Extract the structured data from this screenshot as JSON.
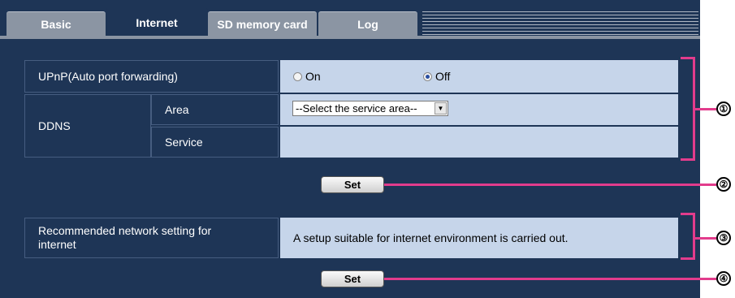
{
  "tabs": [
    {
      "label": "Basic",
      "active": false
    },
    {
      "label": "Internet",
      "active": true
    },
    {
      "label": "SD memory card",
      "active": false
    },
    {
      "label": "Log",
      "active": false
    }
  ],
  "upnp": {
    "label": "UPnP(Auto port forwarding)",
    "options": [
      "On",
      "Off"
    ],
    "selected": "Off"
  },
  "ddns": {
    "label": "DDNS",
    "area_label": "Area",
    "area_value": "--Select the service area--",
    "service_label": "Service",
    "service_value": ""
  },
  "set_button_1": "Set",
  "recommended": {
    "label": "Recommended network setting for internet",
    "description": "A setup suitable for internet environment is carried out."
  },
  "set_button_2": "Set",
  "callouts": [
    "①",
    "②",
    "③",
    "④"
  ],
  "colors": {
    "panel_bg": "#1e3556",
    "value_bg": "#c6d5ea",
    "annotation": "#e23c8c"
  }
}
